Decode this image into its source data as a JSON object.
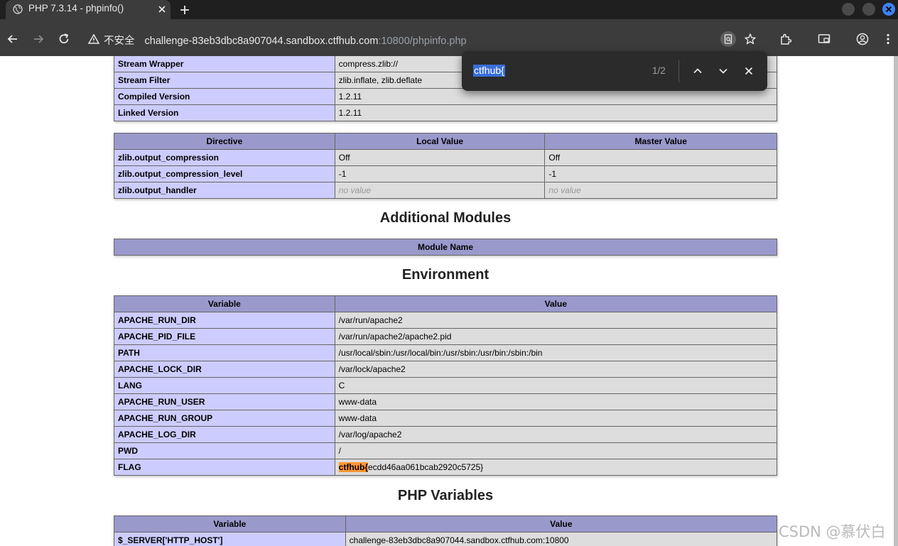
{
  "browser": {
    "tab_title": "PHP 7.3.14 - phpinfo()",
    "insecure_label": "不安全",
    "url_host": "challenge-83eb3dbc8a907044.sandbox.ctfhub.com",
    "url_rest": ":10800/phpinfo.php",
    "icons": [
      "globe-icon",
      "close-icon",
      "plus-icon",
      "back-icon",
      "forward-icon",
      "reload-icon",
      "warning-icon",
      "lens-icon",
      "star-icon",
      "extensions-icon",
      "cast-icon",
      "profile-icon",
      "menu-icon"
    ]
  },
  "find": {
    "query": "ctfhub{",
    "count": "1/2"
  },
  "zlib_top": {
    "rows": [
      [
        "Stream Wrapper",
        "compress.zlib://"
      ],
      [
        "Stream Filter",
        "zlib.inflate, zlib.deflate"
      ],
      [
        "Compiled Version",
        "1.2.11"
      ],
      [
        "Linked Version",
        "1.2.11"
      ]
    ]
  },
  "zlib_directives": {
    "headers": [
      "Directive",
      "Local Value",
      "Master Value"
    ],
    "rows": [
      [
        "zlib.output_compression",
        "Off",
        "Off"
      ],
      [
        "zlib.output_compression_level",
        "-1",
        "-1"
      ],
      [
        "zlib.output_handler",
        "no value",
        "no value"
      ]
    ]
  },
  "additional_modules": {
    "title": "Additional Modules",
    "header": "Module Name"
  },
  "environment": {
    "title": "Environment",
    "headers": [
      "Variable",
      "Value"
    ],
    "rows": [
      [
        "APACHE_RUN_DIR",
        "/var/run/apache2"
      ],
      [
        "APACHE_PID_FILE",
        "/var/run/apache2/apache2.pid"
      ],
      [
        "PATH",
        "/usr/local/sbin:/usr/local/bin:/usr/sbin:/usr/bin:/sbin:/bin"
      ],
      [
        "APACHE_LOCK_DIR",
        "/var/lock/apache2"
      ],
      [
        "LANG",
        "C"
      ],
      [
        "APACHE_RUN_USER",
        "www-data"
      ],
      [
        "APACHE_RUN_GROUP",
        "www-data"
      ],
      [
        "APACHE_LOG_DIR",
        "/var/log/apache2"
      ],
      [
        "PWD",
        "/"
      ]
    ],
    "flag_name": "FLAG",
    "flag_match": "ctfhub{",
    "flag_rest": "ecdd46aa061bcab2920c5725}"
  },
  "php_variables": {
    "title": "PHP Variables",
    "headers": [
      "Variable",
      "Value"
    ],
    "rows": [
      [
        "$_SERVER['HTTP_HOST']",
        "challenge-83eb3dbc8a907044.sandbox.ctfhub.com:10800"
      ]
    ]
  },
  "watermark": "CSDN @慕伏白",
  "colors": {
    "header_bg": "#9999cc",
    "key_bg": "#ccccff",
    "value_bg": "#dddddd",
    "find_highlight": "#ff9632",
    "find_query_bg": "#3a6ed8"
  }
}
